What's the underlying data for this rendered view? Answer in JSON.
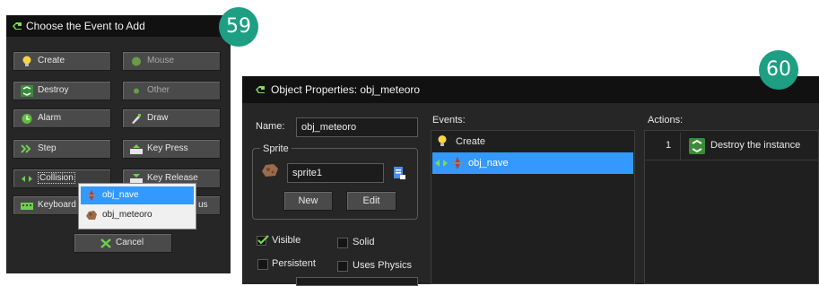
{
  "badges": {
    "first": "59",
    "second": "60"
  },
  "event_dialog": {
    "title": "Choose the Event to Add",
    "buttons": {
      "create": "Create",
      "mouse": "Mouse",
      "destroy": "Destroy",
      "other": "Other",
      "alarm": "Alarm",
      "draw": "Draw",
      "step": "Step",
      "key_press": "Key Press",
      "collision": "Collision",
      "key_release": "Key Release",
      "keyboard": "Keyboard",
      "async_partial": "us",
      "cancel": "Cancel"
    },
    "collision_menu": {
      "items": [
        "obj_nave",
        "obj_meteoro"
      ],
      "selected": "obj_nave"
    }
  },
  "object_window": {
    "title": "Object Properties: obj_meteoro",
    "name_label": "Name:",
    "name_value": "obj_meteoro",
    "sprite_group_label": "Sprite",
    "sprite_value": "sprite1",
    "new_button": "New",
    "edit_button": "Edit",
    "checkboxes": {
      "visible": {
        "label": "Visible",
        "checked": true
      },
      "solid": {
        "label": "Solid",
        "checked": false
      },
      "persistent": {
        "label": "Persistent",
        "checked": false
      },
      "uses_physics": {
        "label": "Uses Physics",
        "checked": false
      }
    },
    "events_label": "Events:",
    "events": [
      {
        "label": "Create",
        "icon": "lightbulb-icon",
        "selected": false
      },
      {
        "label": "obj_nave",
        "icon": "collision-icon",
        "selected": true
      }
    ],
    "actions_label": "Actions:",
    "actions": [
      {
        "number": "1",
        "label": "Destroy the instance",
        "icon": "recycle-icon"
      }
    ]
  },
  "colors": {
    "badge": "#1e9e83",
    "selection": "#3399ff",
    "window_bg": "#262626"
  }
}
